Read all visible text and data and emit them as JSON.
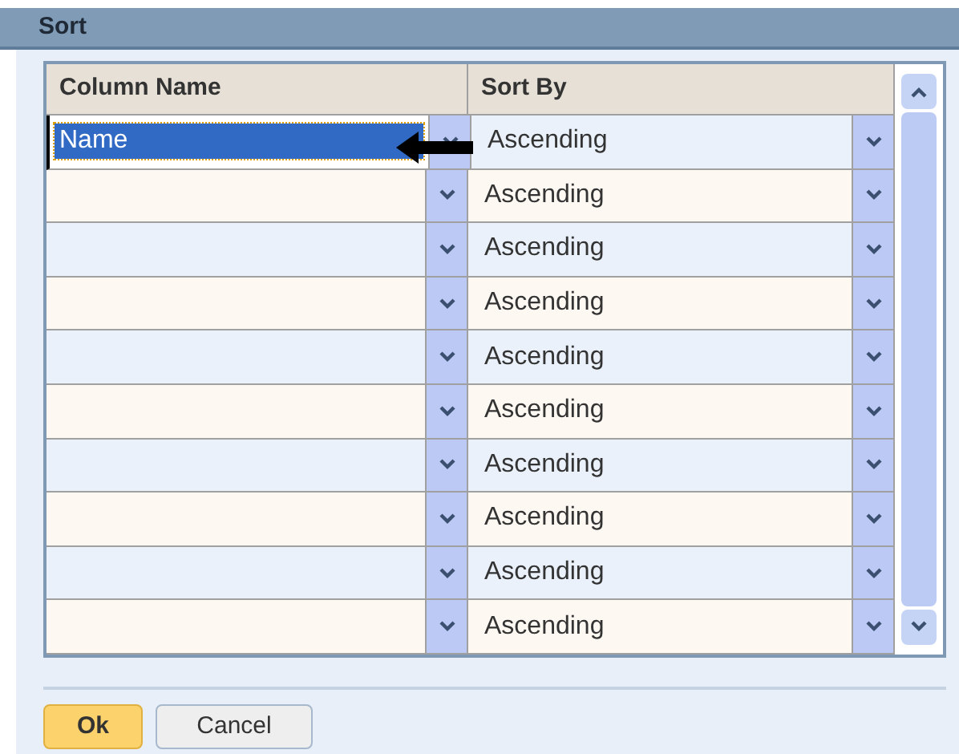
{
  "dialog": {
    "title": "Sort"
  },
  "table": {
    "columns": [
      "Column Name",
      "Sort By"
    ],
    "rows": [
      {
        "column_name": "Name",
        "sort_by": "Ascending",
        "selected": true
      },
      {
        "sort_by": "Ascending",
        "selected": false
      },
      {
        "sort_by": "Ascending",
        "selected": false
      },
      {
        "sort_by": "Ascending",
        "selected": false
      },
      {
        "sort_by": "Ascending",
        "selected": false
      },
      {
        "sort_by": "Ascending",
        "selected": false
      },
      {
        "sort_by": "Ascending",
        "selected": false
      },
      {
        "sort_by": "Ascending",
        "selected": false
      },
      {
        "sort_by": "Ascending",
        "selected": false
      },
      {
        "sort_by": "Ascending",
        "selected": false
      }
    ]
  },
  "buttons": [
    {
      "label": "Ok",
      "kind": "primary"
    },
    {
      "label": "Cancel",
      "kind": "secondary"
    }
  ]
}
